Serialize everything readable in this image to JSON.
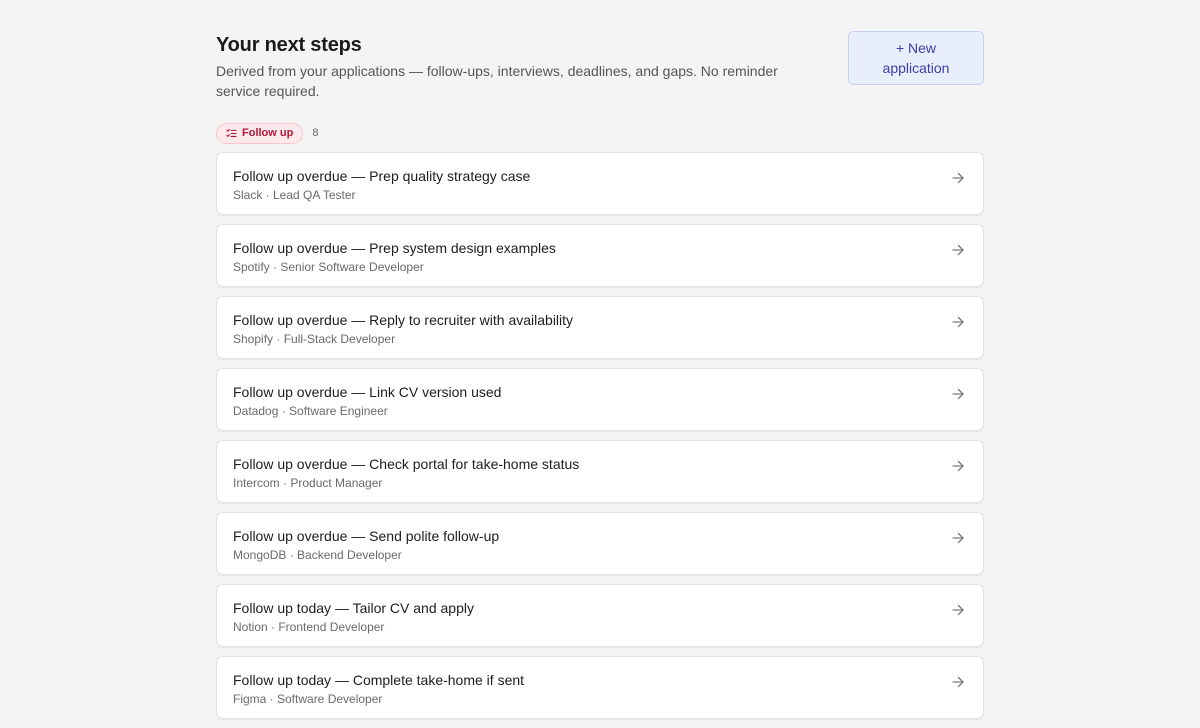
{
  "header": {
    "title": "Your next steps",
    "subtitle": "Derived from your applications — follow-ups, interviews, deadlines, and gaps. No reminder service required.",
    "new_button_label": "+ New application"
  },
  "section": {
    "badge_label": "Follow up",
    "badge_icon": "checklist-icon",
    "count": "8"
  },
  "colors": {
    "background": "#f4f4f4",
    "badge_bg": "#fde9ec",
    "badge_text": "#b3183a",
    "button_bg": "#e8eefc",
    "button_text": "#3b3fa8"
  },
  "items": [
    {
      "title": "Follow up overdue — Prep quality strategy case",
      "meta": "Slack · Lead QA Tester"
    },
    {
      "title": "Follow up overdue — Prep system design examples",
      "meta": "Spotify · Senior Software Developer"
    },
    {
      "title": "Follow up overdue — Reply to recruiter with availability",
      "meta": "Shopify · Full-Stack Developer"
    },
    {
      "title": "Follow up overdue — Link CV version used",
      "meta": "Datadog · Software Engineer"
    },
    {
      "title": "Follow up overdue — Check portal for take-home status",
      "meta": "Intercom · Product Manager"
    },
    {
      "title": "Follow up overdue — Send polite follow-up",
      "meta": "MongoDB · Backend Developer"
    },
    {
      "title": "Follow up today — Tailor CV and apply",
      "meta": "Notion · Frontend Developer"
    },
    {
      "title": "Follow up today — Complete take-home if sent",
      "meta": "Figma · Software Developer"
    }
  ]
}
